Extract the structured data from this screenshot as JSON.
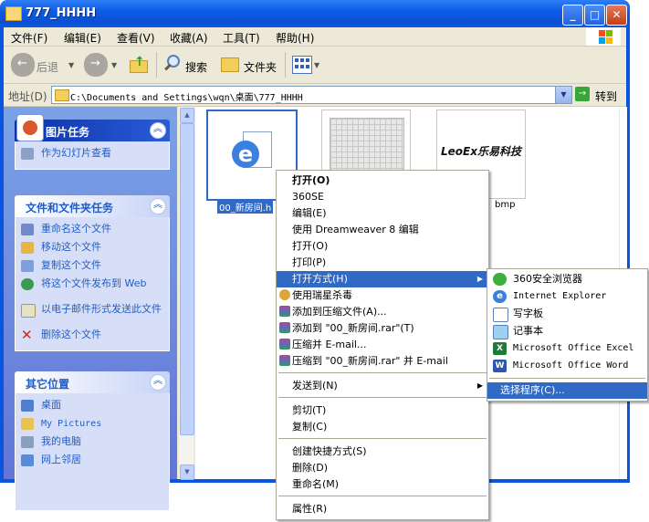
{
  "window": {
    "title": "777_HHHH"
  },
  "menubar": [
    "文件(F)",
    "编辑(E)",
    "查看(V)",
    "收藏(A)",
    "工具(T)",
    "帮助(H)"
  ],
  "toolbar": {
    "back": "后退",
    "search": "搜索",
    "folders": "文件夹"
  },
  "address": {
    "label": "地址(D)",
    "path": "C:\\Documents and Settings\\wqn\\桌面\\777_HHHH",
    "go": "转到"
  },
  "left_pane": {
    "picture_tasks": {
      "title": "图片任务",
      "items": [
        "作为幻灯片查看"
      ]
    },
    "file_tasks": {
      "title": "文件和文件夹任务",
      "items": [
        "重命名这个文件",
        "移动这个文件",
        "复制这个文件",
        "将这个文件发布到 Web",
        "以电子邮件形式发送此文件",
        "删除这个文件"
      ]
    },
    "other_places": {
      "title": "其它位置",
      "items": [
        "桌面",
        "My Pictures",
        "我的电脑",
        "网上邻居"
      ]
    }
  },
  "files": [
    {
      "name": "00_新房间.h",
      "selected": true
    },
    {
      "name": "",
      "selected": false
    },
    {
      "name": "bmp",
      "logo_text": "LeoEx乐易科技",
      "selected": false
    }
  ],
  "context_menu": [
    {
      "label": "打开(O)",
      "bold": true
    },
    {
      "label": "360SE"
    },
    {
      "label": "编辑(E)"
    },
    {
      "label": "使用 Dreamweaver 8 编辑"
    },
    {
      "label": "打开(O)"
    },
    {
      "label": "打印(P)"
    },
    {
      "label": "打开方式(H)",
      "highlight": true,
      "submenu": true
    },
    {
      "label": "使用瑞星杀毒"
    },
    {
      "label": "添加到压缩文件(A)..."
    },
    {
      "label": "添加到 \"00_新房间.rar\"(T)"
    },
    {
      "label": "压缩并 E-mail..."
    },
    {
      "label": "压缩到 \"00_新房间.rar\" 并 E-mail"
    },
    {
      "label": "发送到(N)",
      "submenu": true
    },
    {
      "label": "剪切(T)"
    },
    {
      "label": "复制(C)"
    },
    {
      "label": "创建快捷方式(S)"
    },
    {
      "label": "删除(D)"
    },
    {
      "label": "重命名(M)"
    },
    {
      "label": "属性(R)"
    }
  ],
  "open_with_menu": [
    {
      "label": "360安全浏览器"
    },
    {
      "label": "Internet Explorer"
    },
    {
      "label": "写字板"
    },
    {
      "label": "记事本"
    },
    {
      "label": "Microsoft Office Excel"
    },
    {
      "label": "Microsoft Office Word"
    },
    {
      "label": "选择程序(C)...",
      "highlight": true
    }
  ]
}
